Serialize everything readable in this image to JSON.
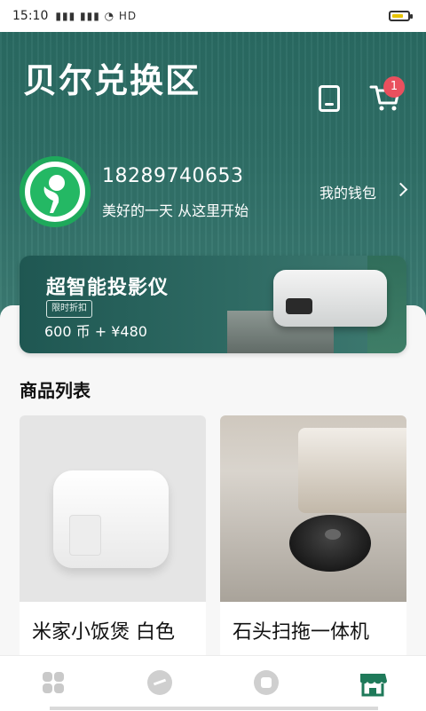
{
  "status": {
    "time": "15:10",
    "icons": "HD"
  },
  "header": {
    "title": "贝尔兑换区",
    "cart_badge": "1"
  },
  "user": {
    "phone": "18289740653",
    "slogan": "美好的一天 从这里开始",
    "wallet_label": "我的钱包"
  },
  "banner": {
    "title": "超智能投影仪",
    "tag": "限时折扣",
    "price": "600 币 + ¥480"
  },
  "section": {
    "title": "商品列表"
  },
  "products": [
    {
      "name": "米家小饭煲 白色"
    },
    {
      "name": "石头扫拖一体机"
    }
  ],
  "colors": {
    "header_green": "#2f6f67",
    "badge_red": "#e9505e",
    "active_tab": "#1f7a5a"
  },
  "icons": {
    "tab1": "grid-icon",
    "tab2": "chat-icon",
    "tab3": "circle-icon",
    "tab4": "store-icon"
  }
}
